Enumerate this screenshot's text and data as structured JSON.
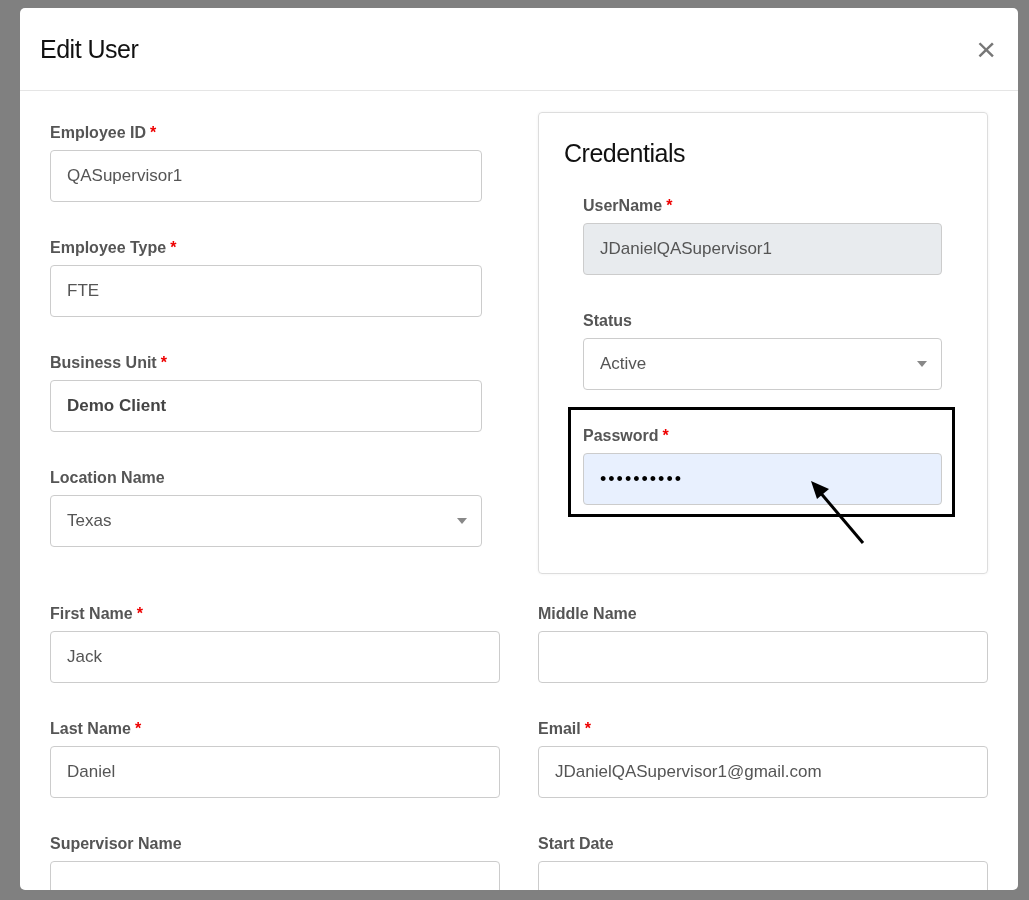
{
  "dialog": {
    "title": "Edit User",
    "close": "×"
  },
  "top_fields": [
    {
      "label": "Employee ID",
      "required_mark": "*",
      "kind": "text",
      "value": "QASupervisor1"
    },
    {
      "label": "Employee Type",
      "required_mark": "*",
      "kind": "text",
      "value": "FTE"
    },
    {
      "label": "Business Unit",
      "required_mark": "*",
      "kind": "text",
      "value": "Demo Client",
      "bold": true
    },
    {
      "label": "Location Name",
      "kind": "select",
      "value": "Texas"
    }
  ],
  "credentials": {
    "title": "Credentials",
    "fields": [
      {
        "label": "UserName",
        "required_mark": "*",
        "kind": "text",
        "value": "JDanielQASupervisor1",
        "disabled": true
      },
      {
        "label": "Status",
        "kind": "select",
        "value": "Active"
      },
      {
        "label": "Password",
        "required_mark": "*",
        "kind": "password",
        "value": "••••••••••",
        "autofilled": true,
        "highlighted": true
      }
    ]
  },
  "fields": [
    {
      "label": "First Name",
      "required_mark": "*",
      "kind": "text",
      "value": "Jack"
    },
    {
      "label": "Middle Name",
      "kind": "text"
    },
    {
      "label": "Last Name",
      "required_mark": "*",
      "kind": "text",
      "value": "Daniel"
    },
    {
      "label": "Email",
      "required_mark": "*",
      "kind": "text",
      "value": "JDanielQASupervisor1@gmail.com"
    },
    {
      "label": "Supervisor Name",
      "kind": "text"
    },
    {
      "label": "Start Date",
      "kind": "text"
    }
  ]
}
